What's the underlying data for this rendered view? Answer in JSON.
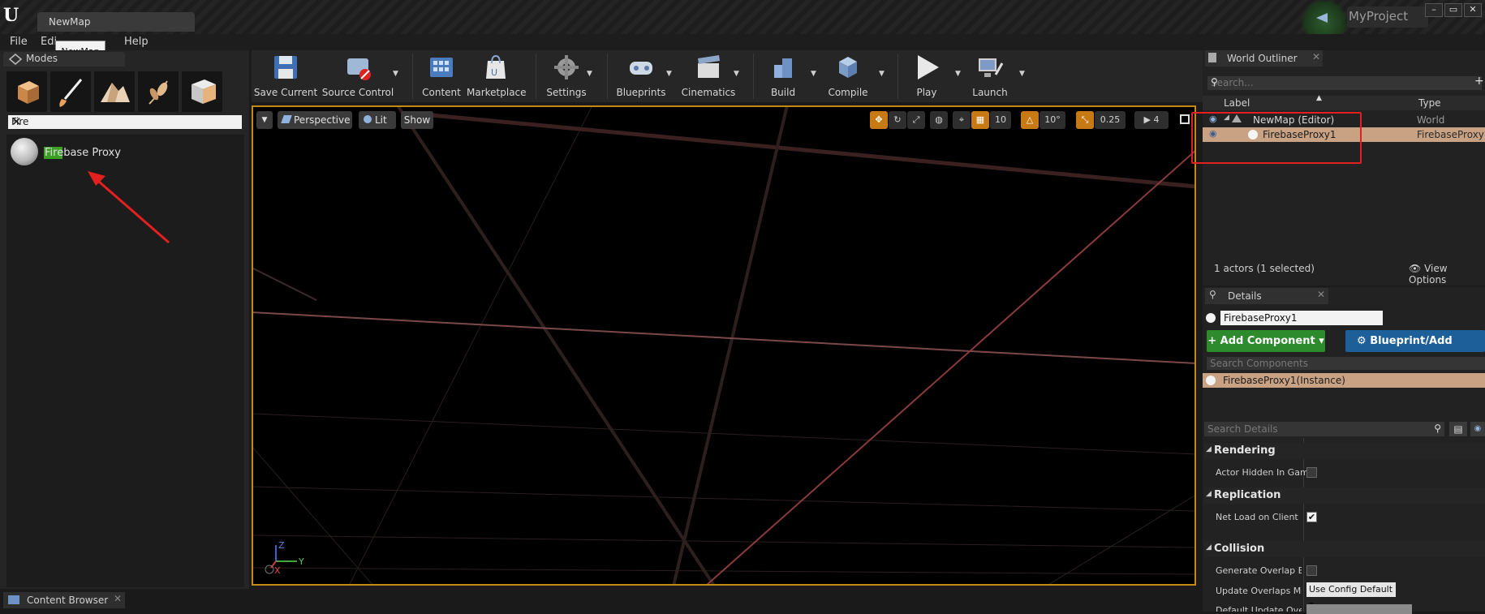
{
  "window": {
    "doc_tab": "NewMap",
    "project": "MyProject",
    "controls": [
      "–",
      "▭",
      "✕"
    ]
  },
  "menu": {
    "items": [
      "File",
      "Edi",
      "Help"
    ],
    "tooltip": "NewMap"
  },
  "modes": {
    "tab_label": "Modes",
    "search_value": "Fire",
    "results": [
      {
        "label": "Firebase Proxy",
        "match": "Fire",
        "rest": "base Proxy"
      }
    ]
  },
  "toolbar": {
    "buttons": [
      {
        "label": "Save Current",
        "icon": "save-icon"
      },
      {
        "label": "Source Control",
        "icon": "source-control-icon"
      },
      {
        "label": "Content",
        "icon": "content-icon"
      },
      {
        "label": "Marketplace",
        "icon": "marketplace-icon"
      },
      {
        "label": "Settings",
        "icon": "settings-icon"
      },
      {
        "label": "Blueprints",
        "icon": "blueprints-icon"
      },
      {
        "label": "Cinematics",
        "icon": "cinematics-icon"
      },
      {
        "label": "Build",
        "icon": "build-icon"
      },
      {
        "label": "Compile",
        "icon": "compile-icon"
      },
      {
        "label": "Play",
        "icon": "play-icon"
      },
      {
        "label": "Launch",
        "icon": "launch-icon"
      }
    ]
  },
  "viewport": {
    "view_mode": "Perspective",
    "lighting": "Lit",
    "show": "Show",
    "grid_snap": "10",
    "rotation_snap": "10°",
    "scale_snap": "0.25",
    "camera_speed": "4",
    "axis_labels": {
      "z": "Z",
      "x": "X",
      "y": "Y"
    }
  },
  "outliner": {
    "tab_label": "World Outliner",
    "search_placeholder": "Search...",
    "col_label": "Label",
    "col_type": "Type",
    "rows": [
      {
        "label": "NewMap (Editor)",
        "type": "World"
      },
      {
        "label": "FirebaseProxy1",
        "type": "FirebaseProxy"
      }
    ],
    "footer": "1 actors (1 selected)",
    "view_options": "View Options"
  },
  "details": {
    "tab_label": "Details",
    "actor_name": "FirebaseProxy1",
    "add_component": "+ Add Component ▾",
    "blueprint_button": "Blueprint/Add Script",
    "search_components_placeholder": "Search Components",
    "component_row": "FirebaseProxy1(Instance)",
    "search_details_placeholder": "Search Details",
    "categories": {
      "rendering": "Rendering",
      "replication": "Replication",
      "collision": "Collision"
    },
    "props": {
      "actor_hidden": "Actor Hidden In Game",
      "net_load": "Net Load on Client",
      "gen_overlap": "Generate Overlap Eve",
      "update_overlaps": "Update Overlaps Met",
      "update_overlaps_value": "Use Config Default",
      "default_update": "Default Update Overl"
    }
  },
  "bottom": {
    "content_browser": "Content Browser"
  },
  "colors": {
    "accent_orange": "#c28a12",
    "selection": "#c9a283",
    "add_component_green": "#2d8a2d",
    "blueprint_blue": "#1c5f99",
    "annotation_red": "#e41f1f"
  }
}
